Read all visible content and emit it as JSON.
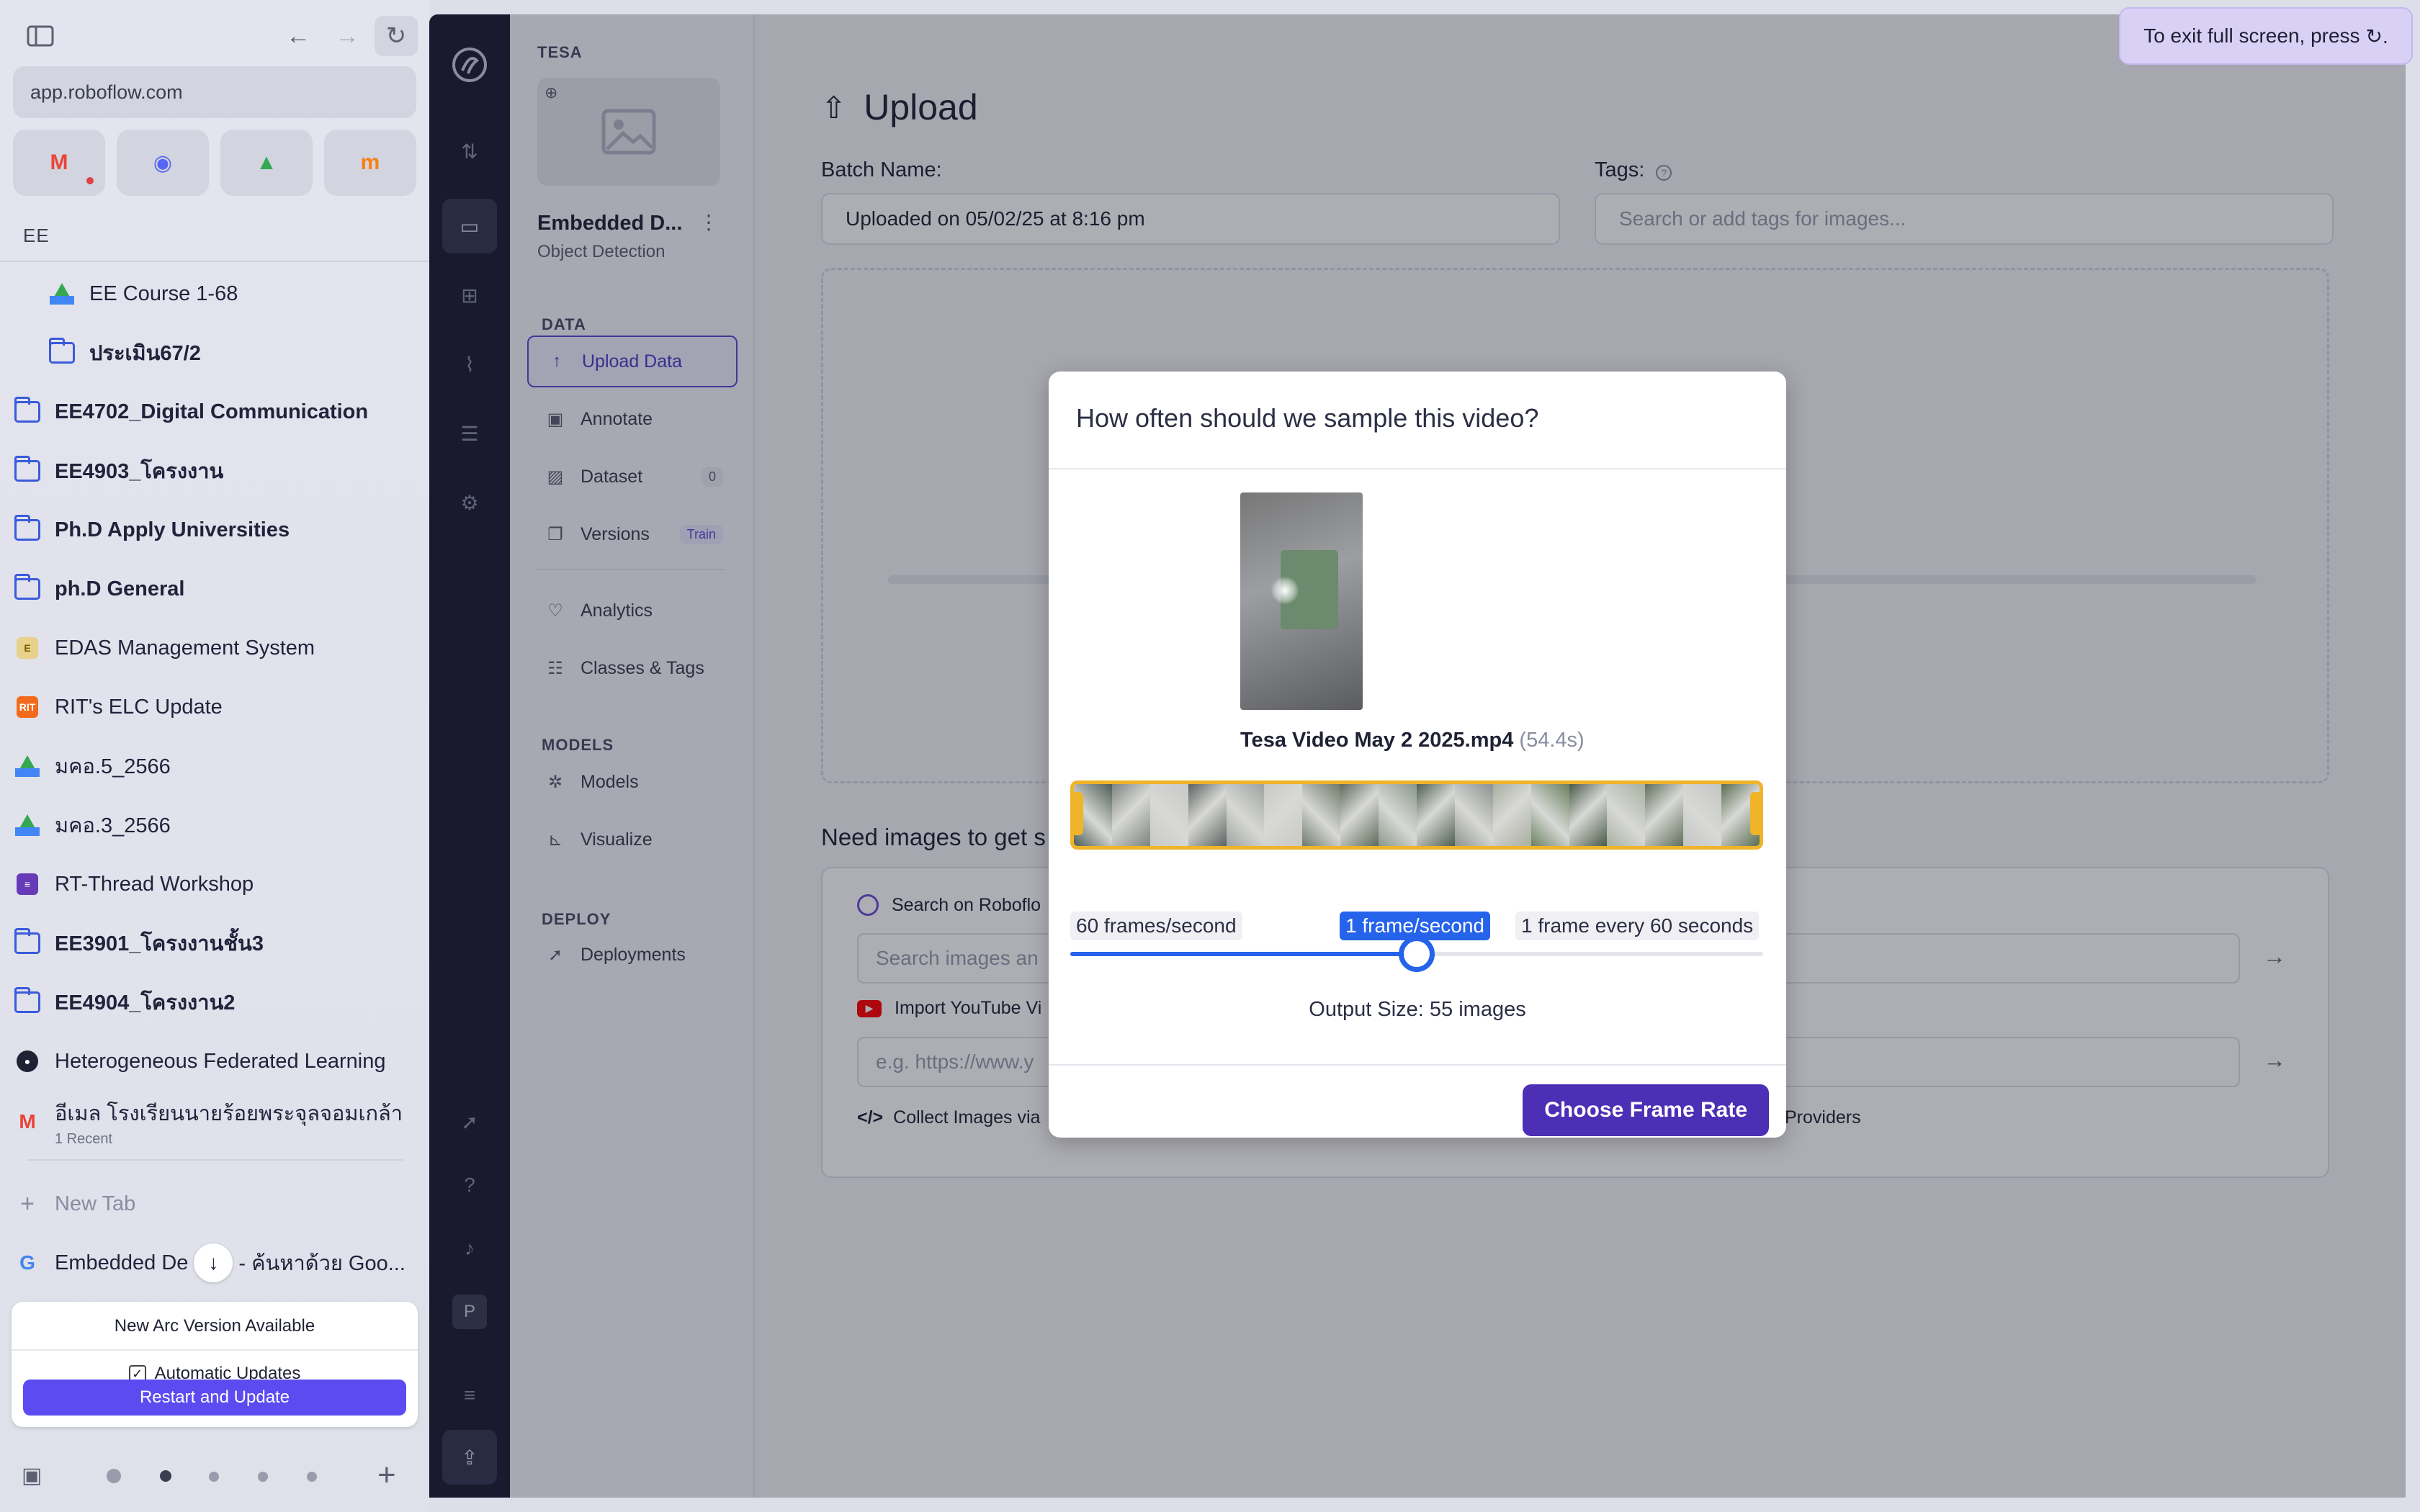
{
  "browser": {
    "url": "app.roboflow.com",
    "favorites": [
      {
        "name": "gmail",
        "glyph": "M",
        "color": "#ea4335",
        "unread": true
      },
      {
        "name": "discord",
        "glyph": "◉",
        "color": "#5865f2",
        "unread": false
      },
      {
        "name": "google-drive",
        "glyph": "▲",
        "color": "#34a853",
        "unread": false
      },
      {
        "name": "moodle",
        "glyph": "m",
        "color": "#f98012",
        "unread": false
      }
    ],
    "space_title": "EE",
    "items": [
      {
        "label": "EE Course 1-68",
        "icon": "drive",
        "bold": false,
        "indent": true
      },
      {
        "label": "ประเมิน67/2",
        "icon": "folder",
        "bold": true,
        "indent": true
      },
      {
        "label": "EE4702_Digital Communication",
        "icon": "folder",
        "bold": true,
        "indent": false
      },
      {
        "label": "EE4903_โครงงาน",
        "icon": "folder",
        "bold": true,
        "indent": false
      },
      {
        "label": "Ph.D Apply Universities",
        "icon": "folder",
        "bold": true,
        "indent": false
      },
      {
        "label": "ph.D General",
        "icon": "folder",
        "bold": true,
        "indent": false
      },
      {
        "label": "EDAS Management System",
        "icon": "edas",
        "bold": false,
        "indent": false
      },
      {
        "label": "RIT's ELC Update",
        "icon": "rit",
        "bold": false,
        "indent": false
      },
      {
        "label": "มคอ.5_2566",
        "icon": "drive",
        "bold": false,
        "indent": false
      },
      {
        "label": "มคอ.3_2566",
        "icon": "drive",
        "bold": false,
        "indent": false
      },
      {
        "label": "RT-Thread Workshop",
        "icon": "form",
        "bold": false,
        "indent": false
      },
      {
        "label": "EE3901_โครงงานชั้น3",
        "icon": "folder",
        "bold": true,
        "indent": false
      },
      {
        "label": "EE4904_โครงงาน2",
        "icon": "folder",
        "bold": true,
        "indent": false
      },
      {
        "label": "Heterogeneous Federated Learning",
        "icon": "github",
        "bold": false,
        "indent": false
      },
      {
        "label": "อีเมล โรงเรียนนายร้อยพระจุลจอมเกล้า",
        "icon": "gmail",
        "bold": false,
        "indent": false,
        "sub": "1 Recent"
      }
    ],
    "new_tab": "New Tab",
    "open_tab": "Embedded De",
    "open_tab_rest": "- ค้นหาด้วย Goo...",
    "update": {
      "title": "New Arc Version Available",
      "auto_label": "Automatic Updates",
      "button": "Restart and Update"
    },
    "fullscreen_toast": "To exit full screen, press"
  },
  "project": {
    "workspace": "TESA",
    "name": "Embedded D...",
    "type": "Object Detection",
    "sections": {
      "data": "DATA",
      "models": "MODELS",
      "deploy": "DEPLOY"
    },
    "nav": {
      "upload": "Upload Data",
      "annotate": "Annotate",
      "dataset": "Dataset",
      "dataset_count": "0",
      "versions": "Versions",
      "versions_badge": "Train",
      "analytics": "Analytics",
      "classes": "Classes & Tags",
      "models": "Models",
      "visualize": "Visualize",
      "deployments": "Deployments"
    },
    "user_initial": "P"
  },
  "upload": {
    "title": "Upload",
    "batch_label": "Batch Name:",
    "batch_value": "Uploaded on 05/02/25 at 8:16 pm",
    "tags_label": "Tags:",
    "tags_placeholder": "Search or add tags for images...",
    "need_images": "Need images to get s",
    "search_label": "Search on Roboflo",
    "search_placeholder": "Search images an",
    "youtube_label": "Import YouTube Vi",
    "youtube_placeholder": "e.g. https://www.y",
    "collect_label": "Collect Images via",
    "providers_label": "Providers"
  },
  "modal": {
    "title": "How often should we sample this video?",
    "video_name": "Tesa Video May 2 2025.mp4",
    "video_duration": "(54.4s)",
    "rate_min": "60 frames/second",
    "rate_selected": "1 frame/second",
    "rate_max": "1 frame every 60 seconds",
    "slider_position": 0.5,
    "output_size": "Output Size: 55 images",
    "button": "Choose Frame Rate",
    "strip_colors": [
      "#4d5d57",
      "#7d847f",
      "#c8c9c7",
      "#5b6360",
      "#9fa3a0",
      "#c9c8c5",
      "#6f7a6b",
      "#5d6b5b",
      "#8b988a",
      "#4f5f4f",
      "#8e938f",
      "#a9ae9f",
      "#6a8160",
      "#4a5a48",
      "#a7b1a2",
      "#5f6f59",
      "#c4c6c3",
      "#5b6d52"
    ]
  },
  "colors": {
    "accent": "#4c2fb4",
    "slider": "#2563eb",
    "strip_border": "#f0b429"
  }
}
